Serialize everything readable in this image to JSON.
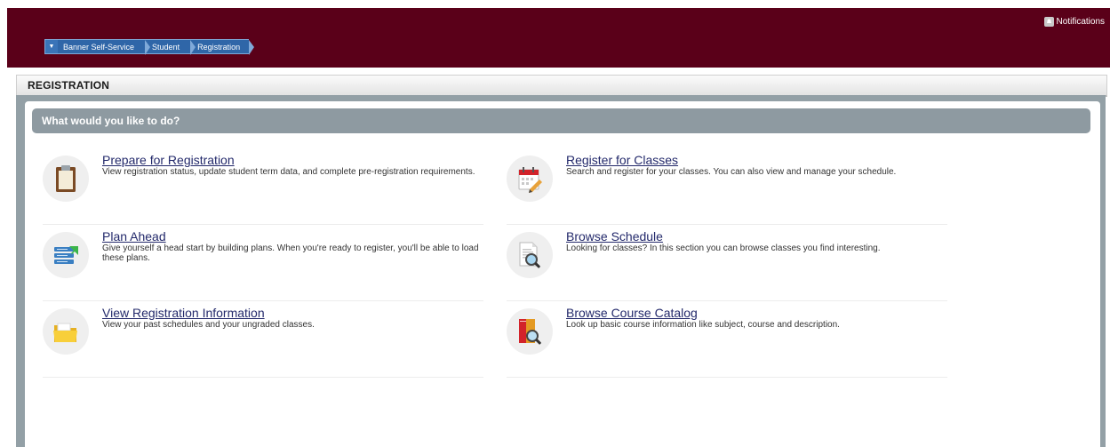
{
  "header": {
    "notifications_label": "Notifications",
    "background": "#5a0019"
  },
  "breadcrumb": {
    "items": [
      "Banner Self-Service",
      "Student",
      "Registration"
    ]
  },
  "page": {
    "title": "REGISTRATION"
  },
  "section": {
    "title": "What would you like to do?"
  },
  "actions": [
    {
      "title": "Prepare for Registration",
      "description": "View registration status, update student term data, and complete pre-registration requirements.",
      "icon": "clipboard-icon"
    },
    {
      "title": "Register for Classes",
      "description": "Search and register for your classes. You can also view and manage your schedule.",
      "icon": "calendar-pencil-icon"
    },
    {
      "title": "Plan Ahead",
      "description": "Give yourself a head start by building plans. When you're ready to register, you'll be able to load these plans.",
      "icon": "list-plan-icon"
    },
    {
      "title": "Browse Schedule",
      "description": "Looking for classes? In this section you can browse classes you find interesting.",
      "icon": "document-magnifier-icon"
    },
    {
      "title": "View Registration Information",
      "description": "View your past schedules and your ungraded classes.",
      "icon": "folder-icon"
    },
    {
      "title": "Browse Course Catalog",
      "description": "Look up basic course information like subject, course and description.",
      "icon": "book-magnifier-icon"
    }
  ]
}
